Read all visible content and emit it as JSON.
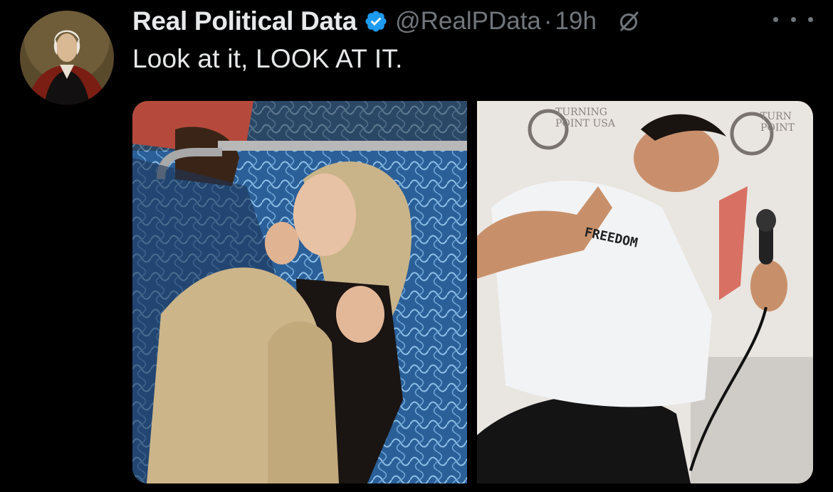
{
  "tweet": {
    "author": {
      "display_name": "Real Political Data",
      "handle": "@RealPData",
      "verified": true,
      "avatar_icon": "portrait-avatar"
    },
    "separator": "·",
    "timestamp": "19h",
    "text": "Look at it, LOOK AT IT.",
    "icons": {
      "verified": "verified-badge-icon",
      "grok": "grok-icon",
      "more": "more-options-icon"
    },
    "media": {
      "left_photo_icon": "photo-woman-on-train",
      "right_photo_icon": "photo-man-with-microphone",
      "right_photo_backdrop_text": [
        "TURNING",
        "POINT USA",
        "TURN",
        "POINT"
      ],
      "right_photo_shirt_text": "FREEDOM"
    }
  },
  "colors": {
    "background": "#000000",
    "primary_text": "#e7e9ea",
    "secondary_text": "#71767b",
    "verified_blue": "#1d9bf0"
  }
}
